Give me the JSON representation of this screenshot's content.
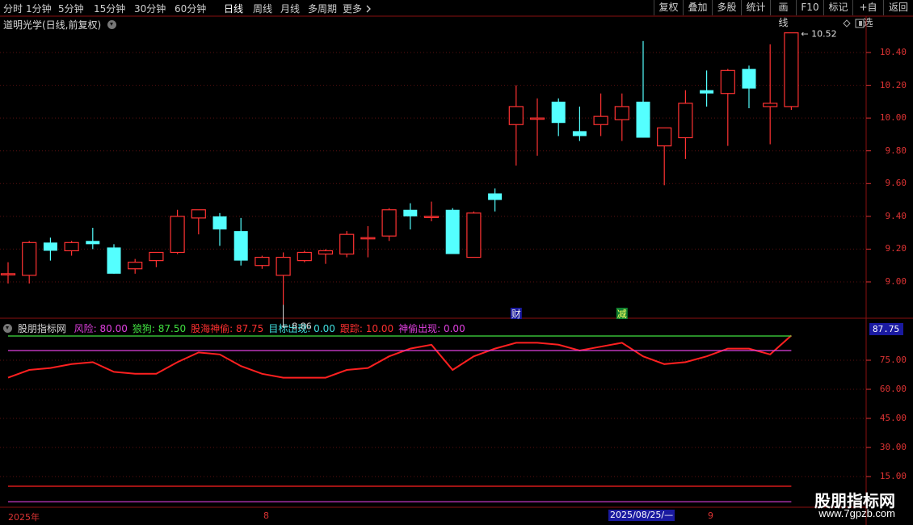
{
  "toolbar": {
    "periods": [
      "分时",
      "1分钟",
      "5分钟",
      "15分钟",
      "30分钟",
      "60分钟",
      "日线",
      "周线",
      "月线",
      "多周期",
      "更多"
    ],
    "active_period": "日线",
    "more_icon": "chevron-right-icon",
    "buttons": [
      "复权",
      "叠加",
      "多股",
      "统计",
      "画线",
      "F10",
      "标记",
      "+自选",
      "返回"
    ]
  },
  "chart": {
    "title": "道明光学(日线,前复权)",
    "high_label": "10.52",
    "low_label": "8.86",
    "event_marks": [
      {
        "text": "财",
        "color": "#e8e8e8",
        "bg": "#1a1aa0",
        "candle": 24
      },
      {
        "text": "减",
        "color": "#ffff60",
        "bg": "#108030",
        "candle": 29
      }
    ],
    "y_ticks": [
      "10.40",
      "10.20",
      "10.00",
      "9.80",
      "9.60",
      "9.40",
      "9.20",
      "9.00"
    ]
  },
  "indicator": {
    "name": "股朋指标网",
    "legend": [
      {
        "label": "风险: 80.00",
        "color": "#e040e0"
      },
      {
        "label": "狼狗: 87.50",
        "color": "#40e040"
      },
      {
        "label": "股海神偷: 87.75",
        "color": "#ff3030"
      },
      {
        "label": "目标出现: 0.00",
        "color": "#40e0e0"
      },
      {
        "label": "跟踪: 10.00",
        "color": "#ff3030"
      },
      {
        "label": "神偷出现: 0.00",
        "color": "#e040e0"
      }
    ],
    "value_box": "87.75",
    "y_ticks": [
      "75.00",
      "60.00",
      "45.00",
      "30.00",
      "15.00"
    ]
  },
  "time_axis": {
    "labels": [
      "2025年",
      "8",
      "9"
    ],
    "cursor_date": "2025/08/25/—"
  },
  "watermark": {
    "brand": "股朋指标网",
    "url": "www.7gpzb.com"
  },
  "chart_data": {
    "type": "candlestick",
    "y_range": [
      8.8,
      10.62
    ],
    "candles": [
      {
        "o": 9.05,
        "h": 9.12,
        "l": 8.99,
        "c": 9.05
      },
      {
        "o": 9.04,
        "h": 9.25,
        "l": 8.99,
        "c": 9.24
      },
      {
        "o": 9.24,
        "h": 9.27,
        "l": 9.13,
        "c": 9.19
      },
      {
        "o": 9.19,
        "h": 9.25,
        "l": 9.16,
        "c": 9.24
      },
      {
        "o": 9.25,
        "h": 9.33,
        "l": 9.2,
        "c": 9.23
      },
      {
        "o": 9.21,
        "h": 9.23,
        "l": 9.05,
        "c": 9.05
      },
      {
        "o": 9.08,
        "h": 9.14,
        "l": 9.05,
        "c": 9.12
      },
      {
        "o": 9.13,
        "h": 9.17,
        "l": 9.09,
        "c": 9.18
      },
      {
        "o": 9.18,
        "h": 9.44,
        "l": 9.17,
        "c": 9.4
      },
      {
        "o": 9.39,
        "h": 9.44,
        "l": 9.29,
        "c": 9.44
      },
      {
        "o": 9.4,
        "h": 9.42,
        "l": 9.22,
        "c": 9.32
      },
      {
        "o": 9.31,
        "h": 9.39,
        "l": 9.1,
        "c": 9.13
      },
      {
        "o": 9.1,
        "h": 9.16,
        "l": 9.08,
        "c": 9.15
      },
      {
        "o": 9.04,
        "h": 9.18,
        "l": 8.86,
        "c": 9.15
      },
      {
        "o": 9.13,
        "h": 9.19,
        "l": 9.12,
        "c": 9.18
      },
      {
        "o": 9.17,
        "h": 9.2,
        "l": 9.11,
        "c": 9.19
      },
      {
        "o": 9.17,
        "h": 9.31,
        "l": 9.15,
        "c": 9.29
      },
      {
        "o": 9.27,
        "h": 9.34,
        "l": 9.15,
        "c": 9.27
      },
      {
        "o": 9.28,
        "h": 9.45,
        "l": 9.25,
        "c": 9.44
      },
      {
        "o": 9.44,
        "h": 9.48,
        "l": 9.32,
        "c": 9.4
      },
      {
        "o": 9.4,
        "h": 9.49,
        "l": 9.37,
        "c": 9.4
      },
      {
        "o": 9.44,
        "h": 9.45,
        "l": 9.17,
        "c": 9.17
      },
      {
        "o": 9.15,
        "h": 9.43,
        "l": 9.15,
        "c": 9.42
      },
      {
        "o": 9.54,
        "h": 9.57,
        "l": 9.43,
        "c": 9.5
      },
      {
        "o": 9.96,
        "h": 10.2,
        "l": 9.71,
        "c": 10.07
      },
      {
        "o": 10.0,
        "h": 10.12,
        "l": 9.77,
        "c": 10.0
      },
      {
        "o": 10.1,
        "h": 10.12,
        "l": 9.89,
        "c": 9.97
      },
      {
        "o": 9.92,
        "h": 10.07,
        "l": 9.86,
        "c": 9.89
      },
      {
        "o": 9.96,
        "h": 10.15,
        "l": 9.89,
        "c": 10.01
      },
      {
        "o": 9.99,
        "h": 10.15,
        "l": 9.86,
        "c": 10.07
      },
      {
        "o": 10.1,
        "h": 10.47,
        "l": 9.88,
        "c": 9.88
      },
      {
        "o": 9.83,
        "h": 9.94,
        "l": 9.59,
        "c": 9.94
      },
      {
        "o": 9.88,
        "h": 10.17,
        "l": 9.75,
        "c": 10.09
      },
      {
        "o": 10.17,
        "h": 10.29,
        "l": 10.07,
        "c": 10.15
      },
      {
        "o": 10.15,
        "h": 10.3,
        "l": 9.83,
        "c": 10.29
      },
      {
        "o": 10.3,
        "h": 10.32,
        "l": 10.06,
        "c": 10.18
      },
      {
        "o": 10.07,
        "h": 10.45,
        "l": 9.84,
        "c": 10.09
      },
      {
        "o": 10.07,
        "h": 10.52,
        "l": 10.05,
        "c": 10.52
      }
    ],
    "indicator_range": [
      8,
      96
    ],
    "indicator_series": [
      {
        "name": "股海神偷",
        "color": "#ff2020",
        "values": [
          66,
          70,
          71,
          73,
          74,
          69,
          68,
          68,
          74,
          79,
          78,
          72,
          68,
          66,
          66,
          66,
          70,
          71,
          77,
          81,
          83,
          70,
          77,
          81,
          84,
          84,
          83,
          80,
          82,
          84,
          77,
          73,
          74,
          77,
          81,
          81,
          78,
          87.75
        ]
      },
      {
        "name": "狼狗",
        "color": "#40e040",
        "values": [
          87.5,
          87.5,
          87.5,
          87.5,
          87.5,
          87.5,
          87.5,
          87.5,
          87.5,
          87.5,
          87.5,
          87.5,
          87.5,
          87.5,
          87.5,
          87.5,
          87.5,
          87.5,
          87.5,
          87.5,
          87.5,
          87.5,
          87.5,
          87.5,
          87.5,
          87.5,
          87.5,
          87.5,
          87.5,
          87.5,
          87.5,
          87.5,
          87.5,
          87.5,
          87.5,
          87.5,
          87.5,
          87.5
        ]
      },
      {
        "name": "风险",
        "color": "#e040e0",
        "values": [
          80,
          80,
          80,
          80,
          80,
          80,
          80,
          80,
          80,
          80,
          80,
          80,
          80,
          80,
          80,
          80,
          80,
          80,
          80,
          80,
          80,
          80,
          80,
          80,
          80,
          80,
          80,
          80,
          80,
          80,
          80,
          80,
          80,
          80,
          80,
          80,
          80,
          80
        ]
      },
      {
        "name": "跟踪",
        "color": "#ff2020",
        "values": [
          10,
          10,
          10,
          10,
          10,
          10,
          10,
          10,
          10,
          10,
          10,
          10,
          10,
          10,
          10,
          10,
          10,
          10,
          10,
          10,
          10,
          10,
          10,
          10,
          10,
          10,
          10,
          10,
          10,
          10,
          10,
          10,
          10,
          10,
          10,
          10,
          10,
          10
        ]
      },
      {
        "name": "神偷出现",
        "color": "#e040e0",
        "values": [
          2,
          2,
          2,
          2,
          2,
          2,
          2,
          2,
          2,
          2,
          2,
          2,
          2,
          2,
          2,
          2,
          2,
          2,
          2,
          2,
          2,
          2,
          2,
          2,
          2,
          2,
          2,
          2,
          2,
          2,
          2,
          2,
          2,
          2,
          2,
          2,
          2,
          2
        ]
      }
    ]
  }
}
